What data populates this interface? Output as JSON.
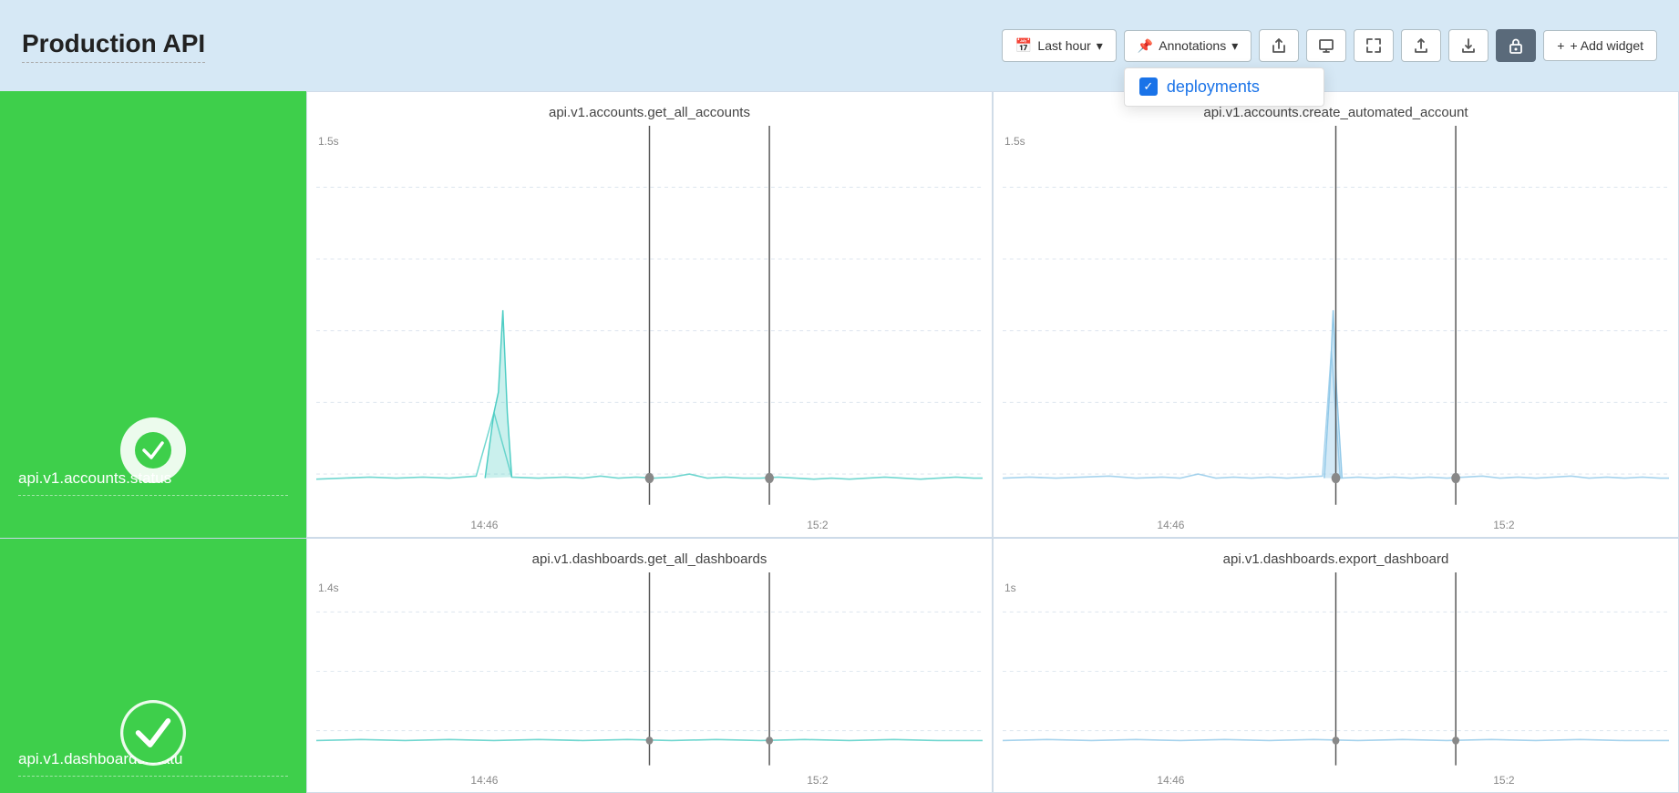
{
  "header": {
    "title": "Production API",
    "toolbar": {
      "time_range_label": "Last hour",
      "annotations_label": "Annotations",
      "add_widget_label": "+ Add widget"
    }
  },
  "annotations_dropdown": {
    "item_label": "deployments",
    "checked": true
  },
  "charts": [
    {
      "id": "status1",
      "type": "status",
      "name": "api.v1.accounts.status",
      "status": "ok"
    },
    {
      "id": "chart1",
      "type": "line",
      "title": "api.v1.accounts.get_all_accounts",
      "y_label": "1.5s",
      "x_labels": [
        "14:46",
        "15:2"
      ],
      "color": "#4ecdc4",
      "row": 0
    },
    {
      "id": "chart2",
      "type": "line",
      "title": "api.v1.accounts.create_automated_account",
      "y_label": "1.5s",
      "x_labels": [
        "14:46",
        "15:2"
      ],
      "color": "#90c8e8",
      "row": 0
    },
    {
      "id": "status2",
      "type": "status",
      "name": "api.v1.dashboards.statu",
      "status": "ok"
    },
    {
      "id": "chart3",
      "type": "line",
      "title": "api.v1.dashboards.get_all_dashboards",
      "y_label": "1.4s",
      "x_labels": [
        "14:46",
        "15:2"
      ],
      "color": "#4ecdc4",
      "row": 1
    },
    {
      "id": "chart4",
      "type": "line",
      "title": "api.v1.dashboards.export_dashboard",
      "y_label": "1s",
      "x_labels": [
        "14:46",
        "15:2"
      ],
      "color": "#90c8e8",
      "row": 1
    }
  ]
}
